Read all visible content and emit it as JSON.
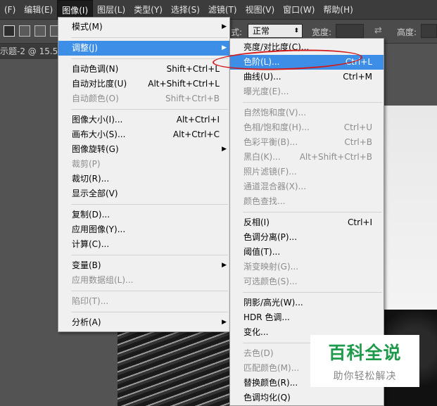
{
  "menubar": {
    "items": [
      "(F)",
      "编辑(E)",
      "图像(I)",
      "图层(L)",
      "类型(Y)",
      "选择(S)",
      "滤镜(T)",
      "视图(V)",
      "窗口(W)",
      "帮助(H)"
    ],
    "active_index": 2
  },
  "options_bar": {
    "style_label": "式:",
    "style_value": "正常",
    "width_label": "宽度:",
    "height_label": "高度:"
  },
  "document_tab": {
    "title": "示题-2 @ 15.5%"
  },
  "image_menu": {
    "items": [
      {
        "label": "模式(M)",
        "shortcut": "",
        "submenu": true,
        "disabled": false
      },
      {
        "sep": true
      },
      {
        "label": "调整(J)",
        "shortcut": "",
        "submenu": true,
        "disabled": false,
        "highlighted": true
      },
      {
        "sep": true
      },
      {
        "label": "自动色调(N)",
        "shortcut": "Shift+Ctrl+L",
        "disabled": false
      },
      {
        "label": "自动对比度(U)",
        "shortcut": "Alt+Shift+Ctrl+L",
        "disabled": false
      },
      {
        "label": "自动颜色(O)",
        "shortcut": "Shift+Ctrl+B",
        "disabled": true
      },
      {
        "sep": true
      },
      {
        "label": "图像大小(I)...",
        "shortcut": "Alt+Ctrl+I",
        "disabled": false
      },
      {
        "label": "画布大小(S)...",
        "shortcut": "Alt+Ctrl+C",
        "disabled": false
      },
      {
        "label": "图像旋转(G)",
        "shortcut": "",
        "submenu": true,
        "disabled": false
      },
      {
        "label": "裁剪(P)",
        "shortcut": "",
        "disabled": true
      },
      {
        "label": "裁切(R)...",
        "shortcut": "",
        "disabled": false
      },
      {
        "label": "显示全部(V)",
        "shortcut": "",
        "disabled": false
      },
      {
        "sep": true
      },
      {
        "label": "复制(D)...",
        "shortcut": "",
        "disabled": false
      },
      {
        "label": "应用图像(Y)...",
        "shortcut": "",
        "disabled": false
      },
      {
        "label": "计算(C)...",
        "shortcut": "",
        "disabled": false
      },
      {
        "sep": true
      },
      {
        "label": "变量(B)",
        "shortcut": "",
        "submenu": true,
        "disabled": false
      },
      {
        "label": "应用数据组(L)...",
        "shortcut": "",
        "disabled": true
      },
      {
        "sep": true
      },
      {
        "label": "陷印(T)...",
        "shortcut": "",
        "disabled": true
      },
      {
        "sep": true
      },
      {
        "label": "分析(A)",
        "shortcut": "",
        "submenu": true,
        "disabled": false
      }
    ]
  },
  "adjust_menu": {
    "items": [
      {
        "label": "亮度/对比度(C)...",
        "shortcut": "",
        "disabled": false
      },
      {
        "label": "色阶(L)...",
        "shortcut": "Ctrl+L",
        "disabled": false,
        "highlighted": true
      },
      {
        "label": "曲线(U)...",
        "shortcut": "Ctrl+M",
        "disabled": false
      },
      {
        "label": "曝光度(E)...",
        "shortcut": "",
        "disabled": true
      },
      {
        "sep": true
      },
      {
        "label": "自然饱和度(V)...",
        "shortcut": "",
        "disabled": true
      },
      {
        "label": "色相/饱和度(H)...",
        "shortcut": "Ctrl+U",
        "disabled": true
      },
      {
        "label": "色彩平衡(B)...",
        "shortcut": "Ctrl+B",
        "disabled": true
      },
      {
        "label": "黑白(K)...",
        "shortcut": "Alt+Shift+Ctrl+B",
        "disabled": true
      },
      {
        "label": "照片滤镜(F)...",
        "shortcut": "",
        "disabled": true
      },
      {
        "label": "通道混合器(X)...",
        "shortcut": "",
        "disabled": true
      },
      {
        "label": "颜色查找...",
        "shortcut": "",
        "disabled": true
      },
      {
        "sep": true
      },
      {
        "label": "反相(I)",
        "shortcut": "Ctrl+I",
        "disabled": false
      },
      {
        "label": "色调分离(P)...",
        "shortcut": "",
        "disabled": false
      },
      {
        "label": "阈值(T)...",
        "shortcut": "",
        "disabled": false
      },
      {
        "label": "渐变映射(G)...",
        "shortcut": "",
        "disabled": true
      },
      {
        "label": "可选颜色(S)...",
        "shortcut": "",
        "disabled": true
      },
      {
        "sep": true
      },
      {
        "label": "阴影/高光(W)...",
        "shortcut": "",
        "disabled": false
      },
      {
        "label": "HDR 色调...",
        "shortcut": "",
        "disabled": false
      },
      {
        "label": "变化...",
        "shortcut": "",
        "disabled": false
      },
      {
        "sep": true
      },
      {
        "label": "去色(D)",
        "shortcut": "",
        "disabled": true
      },
      {
        "label": "匹配颜色(M)...",
        "shortcut": "",
        "disabled": true
      },
      {
        "label": "替换颜色(R)...",
        "shortcut": "",
        "disabled": false
      },
      {
        "label": "色调均化(Q)",
        "shortcut": "",
        "disabled": false
      }
    ]
  },
  "watermark": {
    "title": "百科全说",
    "subtitle": "助你轻松解决"
  },
  "colors": {
    "highlight": "#3d8ee6",
    "menubar_bg": "#3c3c3c",
    "annotation": "#d21b1b",
    "watermark_green": "#1d9a4a"
  }
}
